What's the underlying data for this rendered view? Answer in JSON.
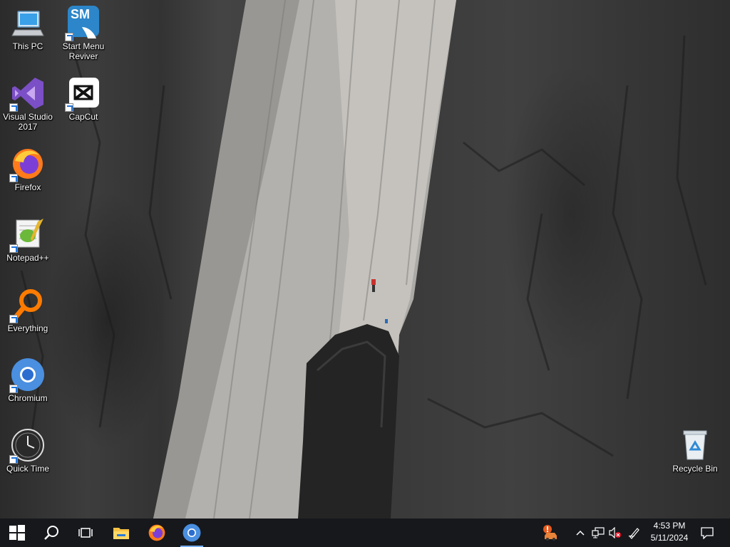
{
  "desktop": {
    "icons": [
      {
        "id": "this-pc",
        "label": "This PC"
      },
      {
        "id": "start-menu-reviver",
        "label": "Start Menu Reviver"
      },
      {
        "id": "visual-studio",
        "label": "Visual Studio 2017"
      },
      {
        "id": "capcut",
        "label": "CapCut"
      },
      {
        "id": "firefox",
        "label": "Firefox"
      },
      {
        "id": "notepadpp",
        "label": "Notepad++"
      },
      {
        "id": "everything",
        "label": "Everything"
      },
      {
        "id": "chromium",
        "label": "Chromium"
      },
      {
        "id": "quick-time",
        "label": "Quick Time"
      },
      {
        "id": "recycle-bin",
        "label": "Recycle Bin"
      }
    ],
    "sm_logo_text": "SM"
  },
  "taskbar": {
    "pinned": [
      "windows-start-icon",
      "search-icon",
      "task-view-icon",
      "file-explorer-icon",
      "firefox-icon",
      "chromium-icon"
    ],
    "tray_icons": [
      "drive-warning-icon",
      "chevron-up-icon",
      "network-icon",
      "volume-muted-icon",
      "pen-icon",
      "notification-icon"
    ],
    "clock": {
      "time": "4:53 PM",
      "date": "5/11/2024"
    }
  },
  "colors": {
    "taskbar": "#16181c",
    "accent": "#1e73d8"
  }
}
